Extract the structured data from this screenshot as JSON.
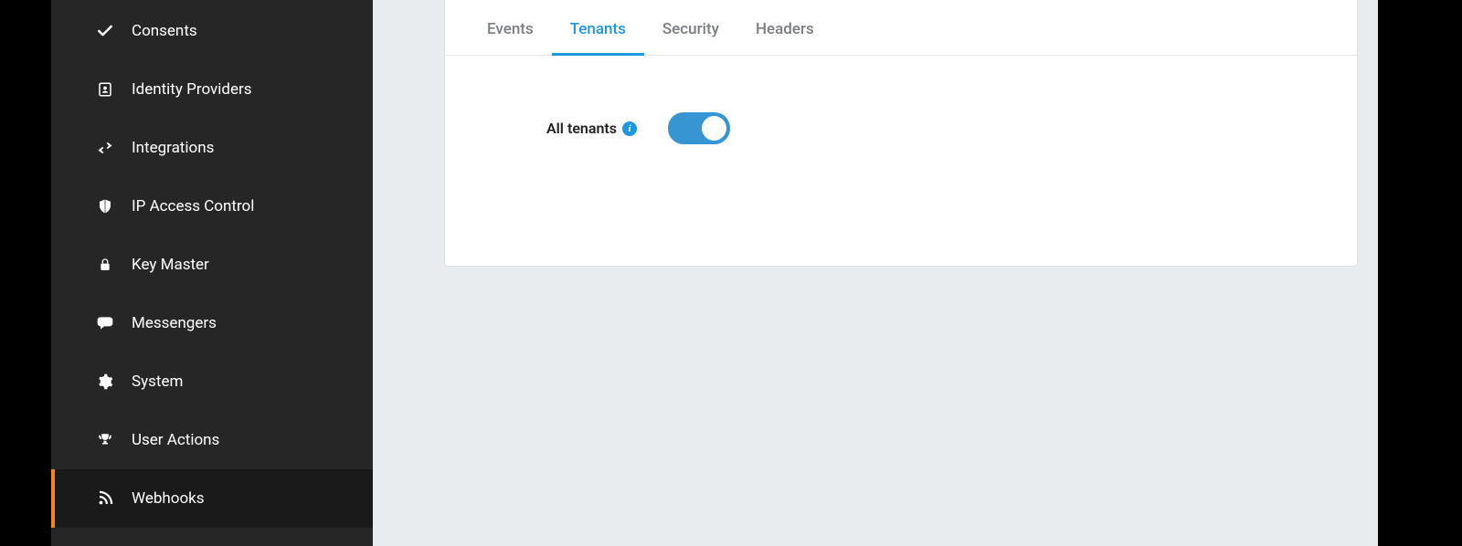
{
  "sidebar": {
    "items": [
      {
        "label": "Consents",
        "icon": "check-icon",
        "active": false
      },
      {
        "label": "Identity Providers",
        "icon": "id-card-icon",
        "active": false
      },
      {
        "label": "Integrations",
        "icon": "swap-arrows-icon",
        "active": false
      },
      {
        "label": "IP Access Control",
        "icon": "shield-icon",
        "active": false
      },
      {
        "label": "Key Master",
        "icon": "lock-icon",
        "active": false
      },
      {
        "label": "Messengers",
        "icon": "chat-icon",
        "active": false
      },
      {
        "label": "System",
        "icon": "gear-icon",
        "active": false
      },
      {
        "label": "User Actions",
        "icon": "trophy-icon",
        "active": false
      },
      {
        "label": "Webhooks",
        "icon": "rss-icon",
        "active": true
      }
    ]
  },
  "tabs": [
    {
      "label": "Events",
      "active": false
    },
    {
      "label": "Tenants",
      "active": true
    },
    {
      "label": "Security",
      "active": false
    },
    {
      "label": "Headers",
      "active": false
    }
  ],
  "form": {
    "all_tenants_label": "All tenants",
    "all_tenants_enabled": true
  },
  "colors": {
    "accent_blue": "#1e97e2",
    "sidebar_bg": "#262626",
    "sidebar_active_indicator": "#f58320",
    "main_bg": "#e8ecef"
  }
}
